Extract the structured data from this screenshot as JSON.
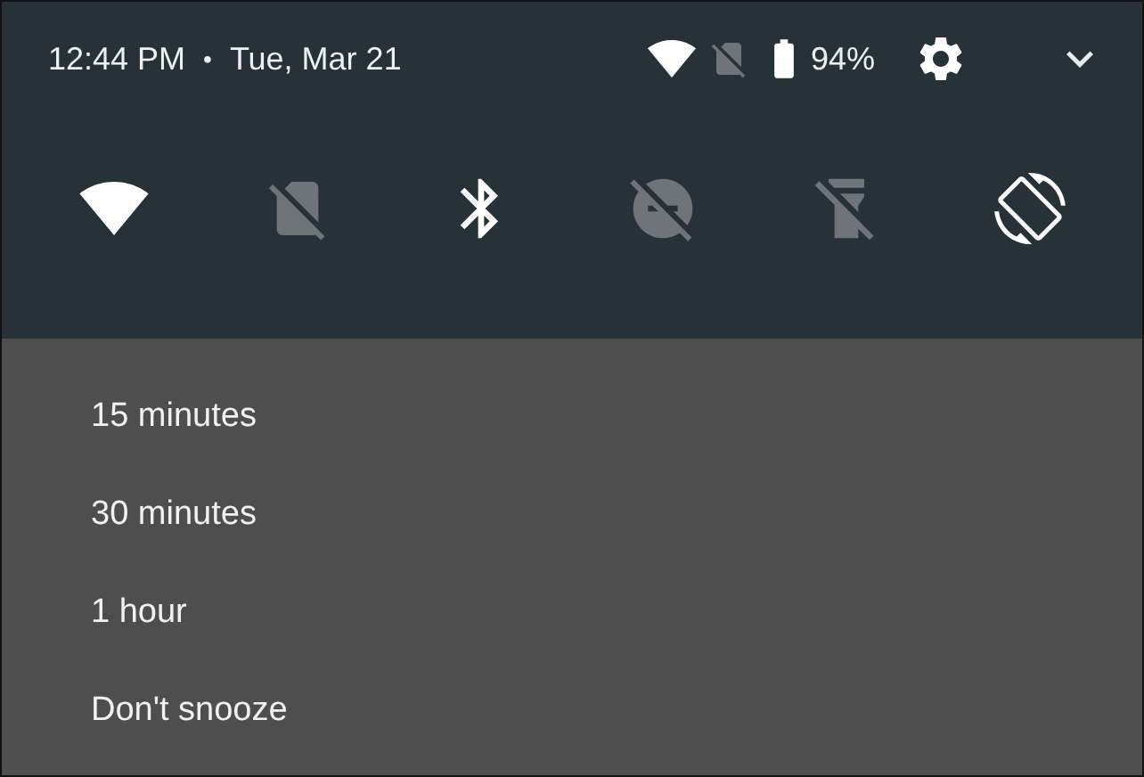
{
  "status_bar": {
    "time": "12:44 PM",
    "separator": "•",
    "date": "Tue, Mar 21",
    "battery_percent": "94%"
  },
  "quick_tiles": [
    {
      "kind": "wifi",
      "on": true
    },
    {
      "kind": "sim",
      "on": false
    },
    {
      "kind": "bluetooth",
      "on": true
    },
    {
      "kind": "dnd",
      "on": false
    },
    {
      "kind": "flashlight",
      "on": false
    },
    {
      "kind": "rotate",
      "on": true
    }
  ],
  "snooze_options": [
    {
      "label": "15 minutes"
    },
    {
      "label": "30 minutes"
    },
    {
      "label": "1 hour"
    },
    {
      "label": "Don't snooze"
    }
  ]
}
